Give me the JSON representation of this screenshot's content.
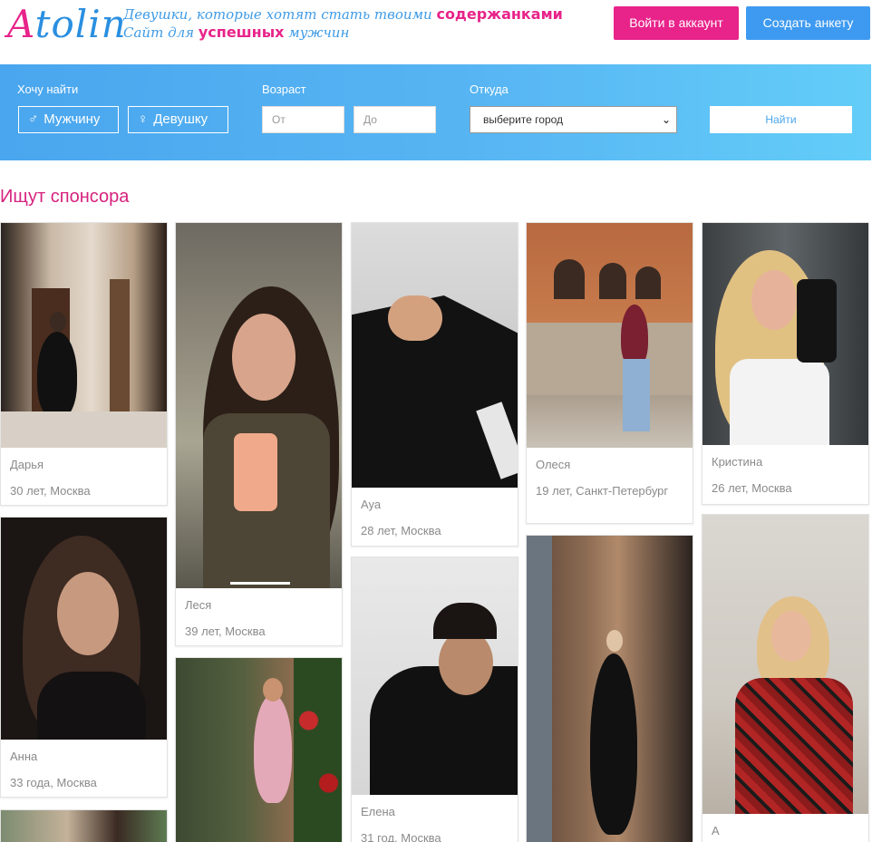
{
  "header": {
    "logo_text": "Atolin",
    "tagline_line1_prefix": "Девушки, которые хотят стать твоими ",
    "tagline_line1_em": "содержанками",
    "tagline_line2_prefix": "Сайт для ",
    "tagline_line2_em": "успешных",
    "tagline_line2_suffix": " мужчин",
    "login_label": "Войти в аккаунт",
    "create_label": "Создать анкету"
  },
  "search": {
    "want_label": "Хочу найти",
    "male_label": "Мужчину",
    "female_label": "Девушку",
    "age_label": "Возраст",
    "age_from_placeholder": "От",
    "age_to_placeholder": "До",
    "from_label": "Откуда",
    "city_selected": "выберите город",
    "find_label": "Найти"
  },
  "section_title": "Ищут спонсора",
  "profiles": [
    {
      "name": "Дарья",
      "info": "30 лет, Москва"
    },
    {
      "name": "Леся",
      "info": "39 лет, Москва"
    },
    {
      "name": "Ауа",
      "info": "28 лет, Москва"
    },
    {
      "name": "Олеся",
      "info": "19 лет, Санкт-Петербург"
    },
    {
      "name": "Кристина",
      "info": "26 лет, Москва"
    },
    {
      "name": "Анна",
      "info": "33 года, Москва"
    },
    {
      "name": "Елена",
      "info": "31 год, Москва"
    },
    {
      "name": "А",
      "info": ""
    }
  ],
  "colors": {
    "brand_pink": "#e8238a",
    "brand_blue": "#3e9af0"
  }
}
